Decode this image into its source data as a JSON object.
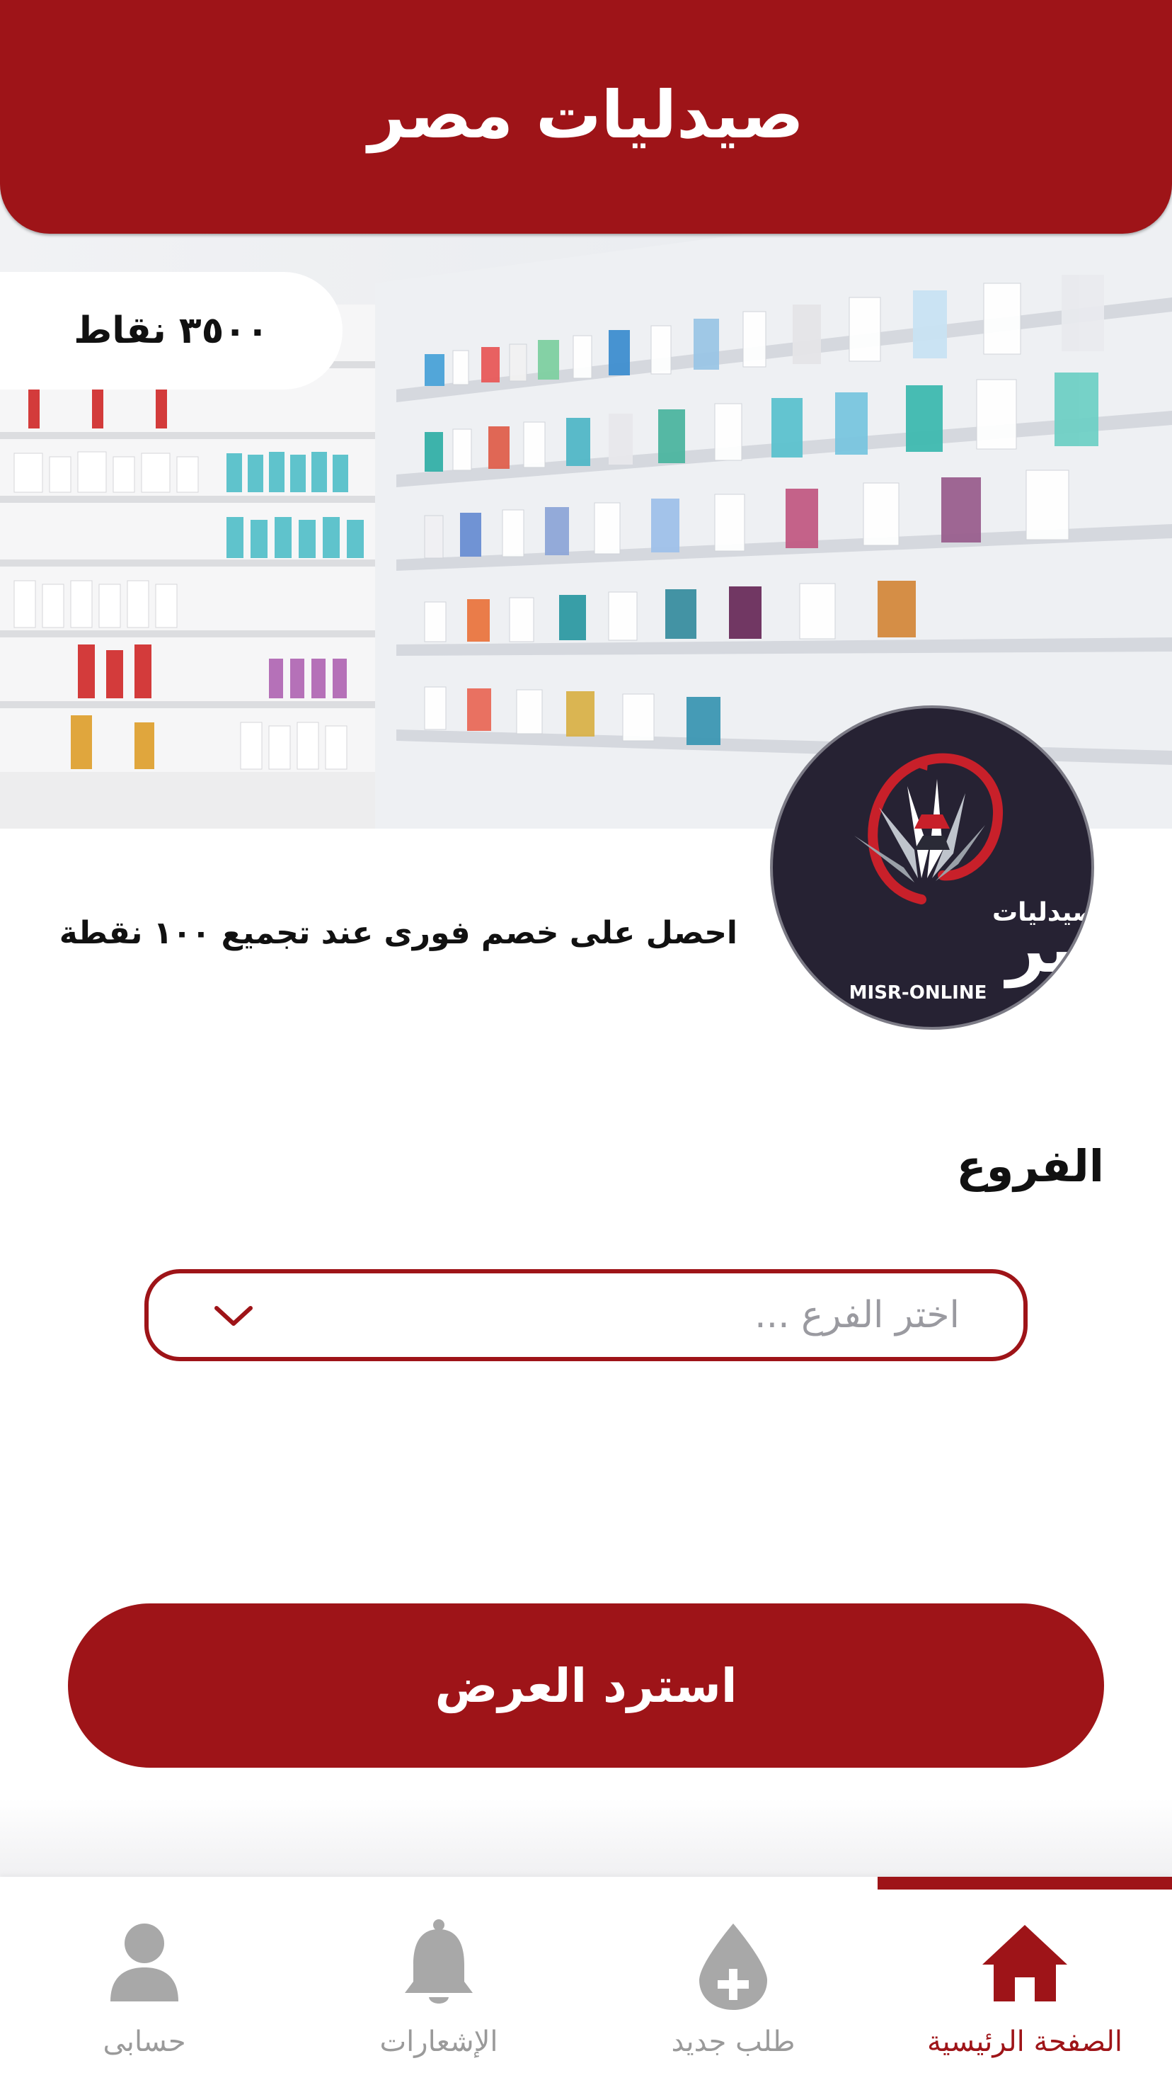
{
  "header": {
    "title": "صيدليات مصر"
  },
  "points": {
    "label": "٣٥٠٠ نقاط"
  },
  "logo": {
    "brand_ar": "صيدليات",
    "brand_big": "مصر",
    "brand_en": "MISR-ONLINE"
  },
  "promo": {
    "text": "احصل على خصم فورى عند تجميع ١٠٠ نقطة"
  },
  "branches": {
    "label": "الفروع",
    "placeholder": "اختر الفرع ..."
  },
  "cta": {
    "label": "استرد العرض"
  },
  "nav": {
    "home": "الصفحة الرئيسية",
    "new_order": "طلب جديد",
    "notifications": "الإشعارات",
    "account": "حسابى"
  },
  "colors": {
    "brand": "#9e1418",
    "inactive": "#9a9a9a"
  }
}
